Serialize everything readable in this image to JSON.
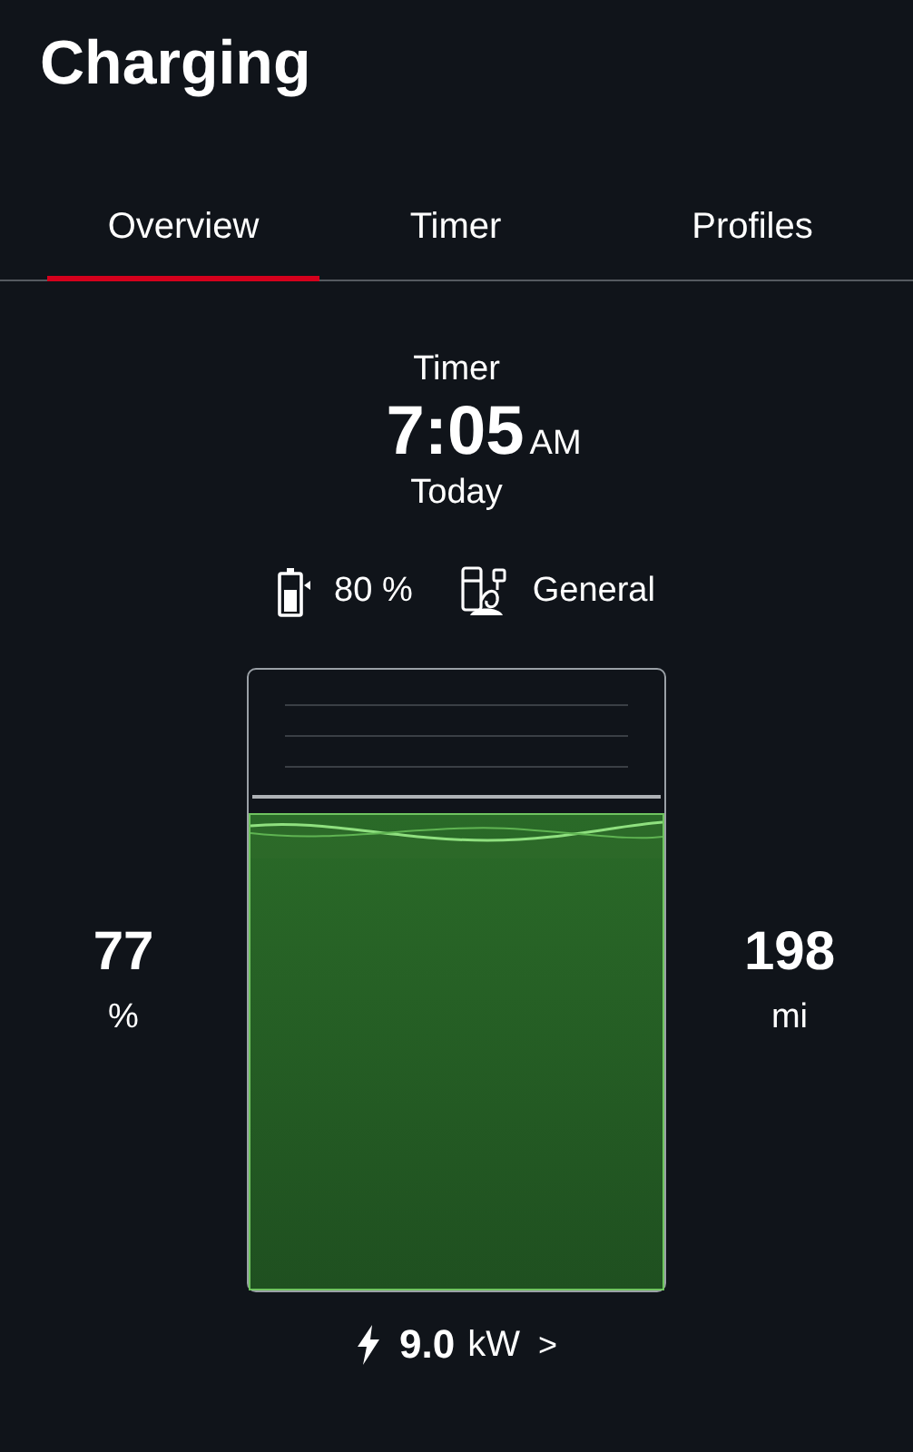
{
  "header": {
    "title": "Charging"
  },
  "tabs": [
    {
      "label": "Overview",
      "selected": true
    },
    {
      "label": "Timer",
      "selected": false
    },
    {
      "label": "Profiles",
      "selected": false
    }
  ],
  "timer": {
    "label": "Timer",
    "time": "7:05",
    "ampm": "AM",
    "day": "Today"
  },
  "info": {
    "target": "80 %",
    "profile": "General"
  },
  "battery": {
    "percent": "77",
    "percent_unit": "%",
    "range": "198",
    "range_unit": "mi"
  },
  "power": {
    "value": "9.0",
    "unit": "kW",
    "chevron": ">"
  }
}
